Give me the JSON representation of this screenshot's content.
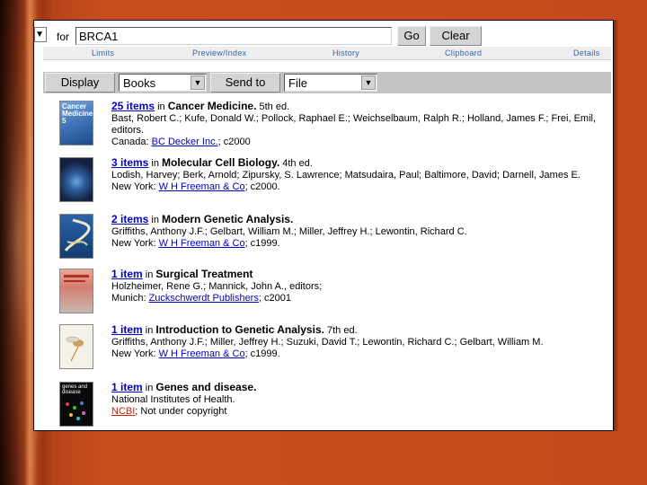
{
  "search": {
    "for_label": "for",
    "query": "BRCA1",
    "go_label": "Go",
    "clear_label": "Clear",
    "db_arrow": "▼"
  },
  "tabs": [
    "Limits",
    "Preview/Index",
    "History",
    "Clipboard",
    "Details"
  ],
  "display_bar": {
    "display_label": "Display",
    "format_value": "Books",
    "send_label": "Send to",
    "sendto_value": "File"
  },
  "results": [
    {
      "count": "25 items",
      "in": " in ",
      "title": "Cancer Medicine.",
      "edition": " 5th ed.",
      "authors": "Bast, Robert C.; Kufe, Donald W.; Pollock, Raphael E.; Weichselbaum, Ralph R.; Holland, James F.; Frei, Emil, editors.",
      "place": "Canada: ",
      "publisher": "BC Decker Inc.",
      "year": "; c2000",
      "cover_text": "Cancer Medicine 5",
      "cover_color": "#4b7fc4"
    },
    {
      "count": "3 items",
      "in": " in ",
      "title": "Molecular Cell Biology.",
      "edition": " 4th ed.",
      "authors": "Lodish, Harvey; Berk, Arnold; Zipursky, S. Lawrence; Matsudaira, Paul; Baltimore, David; Darnell, James E.",
      "place": "New York: ",
      "publisher": "W H Freeman & Co",
      "year": "; c2000.",
      "cover_text": "",
      "cover_color": "#1c2c55"
    },
    {
      "count": "2 items",
      "in": " in ",
      "title": "Modern Genetic Analysis.",
      "edition": "",
      "authors": "Griffiths, Anthony J.F.; Gelbart, William M.; Miller, Jeffrey H.; Lewontin, Richard C.",
      "place": "New York: ",
      "publisher": "W H Freeman & Co",
      "year": "; c1999.",
      "cover_text": "",
      "cover_color": "#1f4f8c"
    },
    {
      "count": "1 item",
      "in": " in ",
      "title": "Surgical Treatment",
      "edition": "",
      "authors": "Holzheimer, Rene G.; Mannick, John A., editors;",
      "place": "Munich: ",
      "publisher": "Zuckschwerdt Publishers",
      "year": "; c2001",
      "cover_text": "",
      "cover_color": "#d8897a"
    },
    {
      "count": "1 item",
      "in": " in ",
      "title": "Introduction to Genetic Analysis.",
      "edition": " 7th ed.",
      "authors": "Griffiths, Anthony J.F.; Miller, Jeffrey H.; Suzuki, David T.; Lewontin, Richard C.; Gelbart, William M.",
      "place": "New York: ",
      "publisher": "W H Freeman & Co",
      "year": "; c1999.",
      "cover_text": "",
      "cover_color": "#f2f0e8"
    },
    {
      "count": "1 item",
      "in": " in ",
      "title": "Genes and disease.",
      "edition": "",
      "authors": "National Institutes of Health.",
      "place": "",
      "publisher": "NCBI",
      "year": "; Not under copyright",
      "cover_text": "genes and disease",
      "cover_color": "#0a0a0a"
    }
  ]
}
